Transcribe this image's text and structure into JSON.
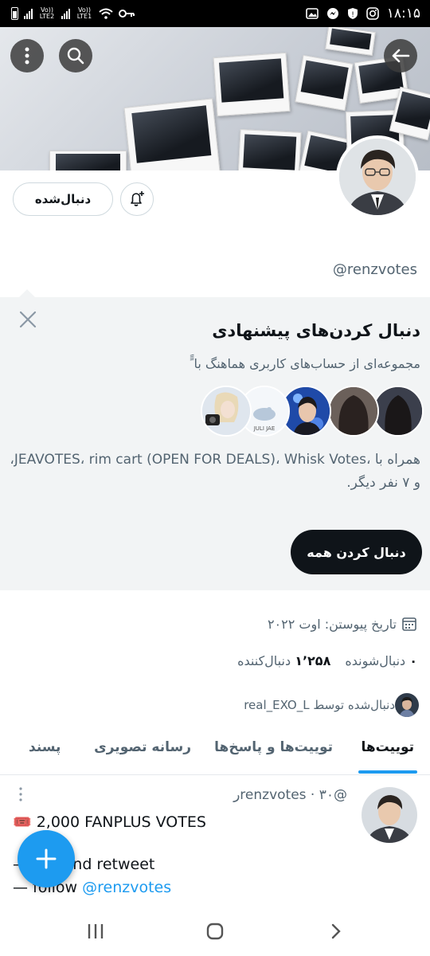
{
  "status_bar": {
    "sim1_label": "Vo)) LTE2",
    "sim2_label": "Vo)) LTE1",
    "time": "۱۸:۱۵",
    "icons": [
      "battery-icon",
      "signal-icon",
      "wifi-icon",
      "vpn-key-icon",
      "gallery-icon",
      "messenger-icon",
      "shield-icon",
      "instagram-icon"
    ]
  },
  "header": {
    "menu_icon": "more-vertical-icon",
    "search_icon": "search-icon",
    "back_icon": "back-arrow-icon"
  },
  "profile": {
    "following_button": "دنبال‌شده",
    "bell_icon": "notification-bell-icon",
    "handle": "@renzvotes",
    "joined": "تاریخ پیوستن: اوت ۲۰۲۲",
    "following_count": "۰",
    "following_label": "دنبال‌شونده",
    "followers_count": "۱٬۲۵۸",
    "followers_label": "دنبال‌کننده",
    "followed_by": "دنبال‌شده توسط real_EXO_L"
  },
  "suggested": {
    "title": "دنبال کردن‌های پیشنهادی",
    "subtitle": "مجموعه‌ای از حساب‌های کاربری هماهنگ با ًً",
    "description": "همراه با ،JEAVOTES، rim cart (OPEN FOR DEALS)، Whisk Votes، و ۷ نفر دیگر.",
    "follow_all": "دنبال کردن همه",
    "close_icon": "close-icon",
    "avatar_tag": "JULI JAE"
  },
  "tabs": [
    {
      "label": "توییت‌ها",
      "active": true
    },
    {
      "label": "توییت‌ها و پاسخ‌ها",
      "active": false
    },
    {
      "label": "رسانه تصویری",
      "active": false
    },
    {
      "label": "پسند",
      "active": false
    }
  ],
  "tweet": {
    "header": "@renzvotes · ۳۰ر",
    "line1": "🎟️ 2,000 FANPLUS VOTES",
    "line2": "— like and retweet",
    "line3_prefix": "— follow ",
    "line3_link": "@renzvotes"
  },
  "fab": {
    "icon": "plus-icon"
  },
  "nav": {
    "icons": [
      "recent-apps-icon",
      "home-icon",
      "back-chevron-icon"
    ]
  },
  "colors": {
    "accent": "#1d9bf0",
    "text": "#0f1419",
    "muted": "#536471",
    "panel": "#f2f4f5"
  }
}
